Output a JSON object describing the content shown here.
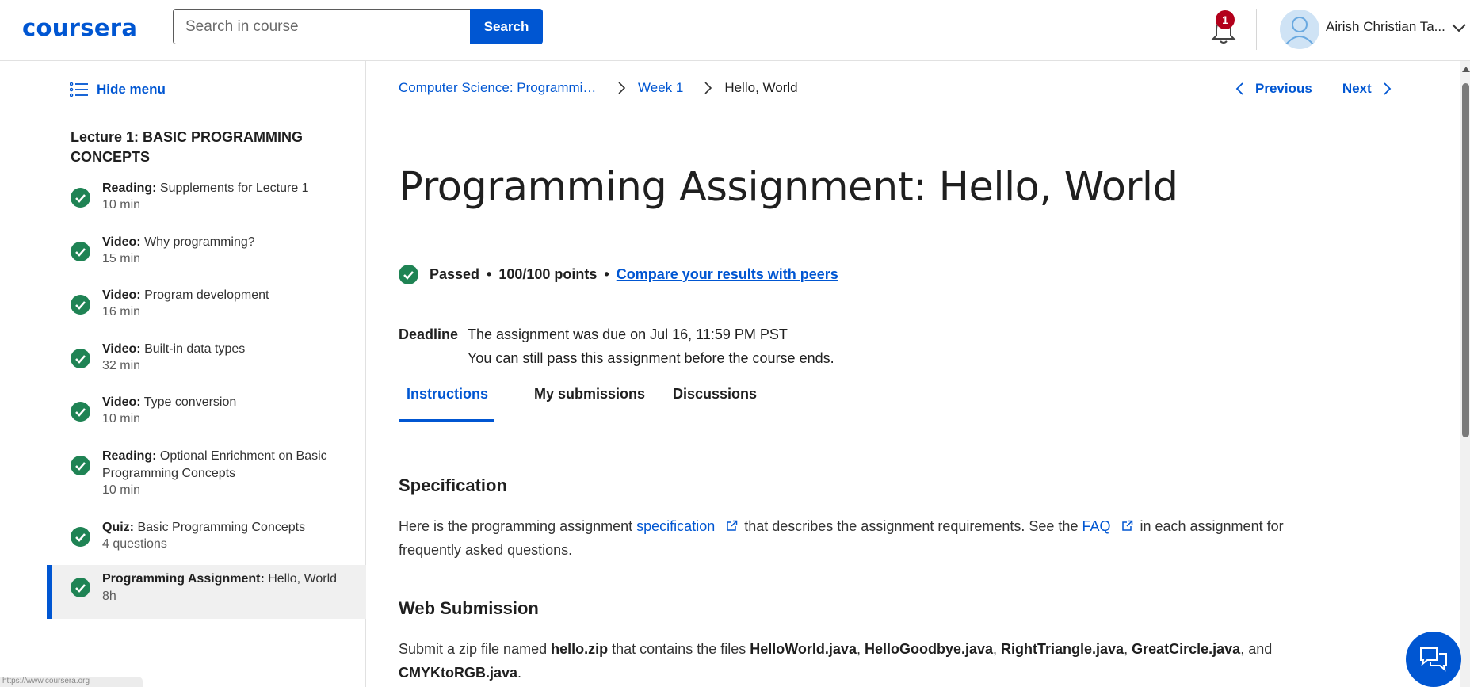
{
  "header": {
    "logo": "coursera",
    "search_placeholder": "Search in course",
    "search_button": "Search",
    "notification_count": "1",
    "user_name": "Airish Christian Ta...",
    "icons": [
      "bell-icon",
      "avatar-icon",
      "chevron-down-icon"
    ]
  },
  "sidebar": {
    "hide_menu": "Hide menu",
    "lecture_title": "Lecture 1: BASIC PROGRAMMING CONCEPTS",
    "items": [
      {
        "type": "Reading:",
        "title": "Supplements for Lecture 1",
        "duration": "10 min",
        "completed": true
      },
      {
        "type": "Video:",
        "title": "Why programming?",
        "duration": "15 min",
        "completed": true
      },
      {
        "type": "Video:",
        "title": "Program development",
        "duration": "16 min",
        "completed": true
      },
      {
        "type": "Video:",
        "title": "Built-in data types",
        "duration": "32 min",
        "completed": true
      },
      {
        "type": "Video:",
        "title": "Type conversion",
        "duration": "10 min",
        "completed": true
      },
      {
        "type": "Reading:",
        "title": "Optional Enrichment on Basic Programming Concepts",
        "duration": "10 min",
        "completed": true
      },
      {
        "type": "Quiz:",
        "title": "Basic Programming Concepts",
        "duration": "4 questions",
        "completed": true
      },
      {
        "type": "Programming Assignment:",
        "title": "Hello, World",
        "duration": "8h",
        "completed": true,
        "active": true
      }
    ]
  },
  "main": {
    "breadcrumb": {
      "course": "Computer Science: Programmin…",
      "week": "Week 1",
      "current": "Hello, World"
    },
    "nav": {
      "previous": "Previous",
      "next": "Next"
    },
    "title": "Programming Assignment: Hello, World",
    "status": {
      "passed": "Passed",
      "dot": "•",
      "points": "100/100 points",
      "compare_link": "Compare your results with peers"
    },
    "deadline": {
      "label": "Deadline",
      "line1": "The assignment was due on Jul 16, 11:59 PM PST",
      "line2": "You can still pass this assignment before the course ends."
    },
    "tabs": [
      "Instructions",
      "My submissions",
      "Discussions"
    ],
    "active_tab": "Instructions",
    "spec": {
      "heading": "Specification",
      "text1": "Here is the programming assignment",
      "link1": "specification",
      "text2": "that describes the assignment requirements. See the",
      "link2": "FAQ",
      "text3": "in each assignment for frequently asked questions."
    },
    "web": {
      "heading": "Web Submission",
      "t1": "Submit a zip file named",
      "f0": "hello.zip",
      "t2": "that contains the files",
      "f1": "HelloWorld.java",
      "f2": "HelloGoodbye.java",
      "f3": "RightTriangle.java",
      "f4": "GreatCircle.java",
      "and": ", and",
      "f5": "CMYKtoRGB.java"
    }
  },
  "status_url": "https://www.coursera.org",
  "colors": {
    "brand": "#0056d2",
    "success": "#1f8354",
    "badge": "#b3001b"
  }
}
